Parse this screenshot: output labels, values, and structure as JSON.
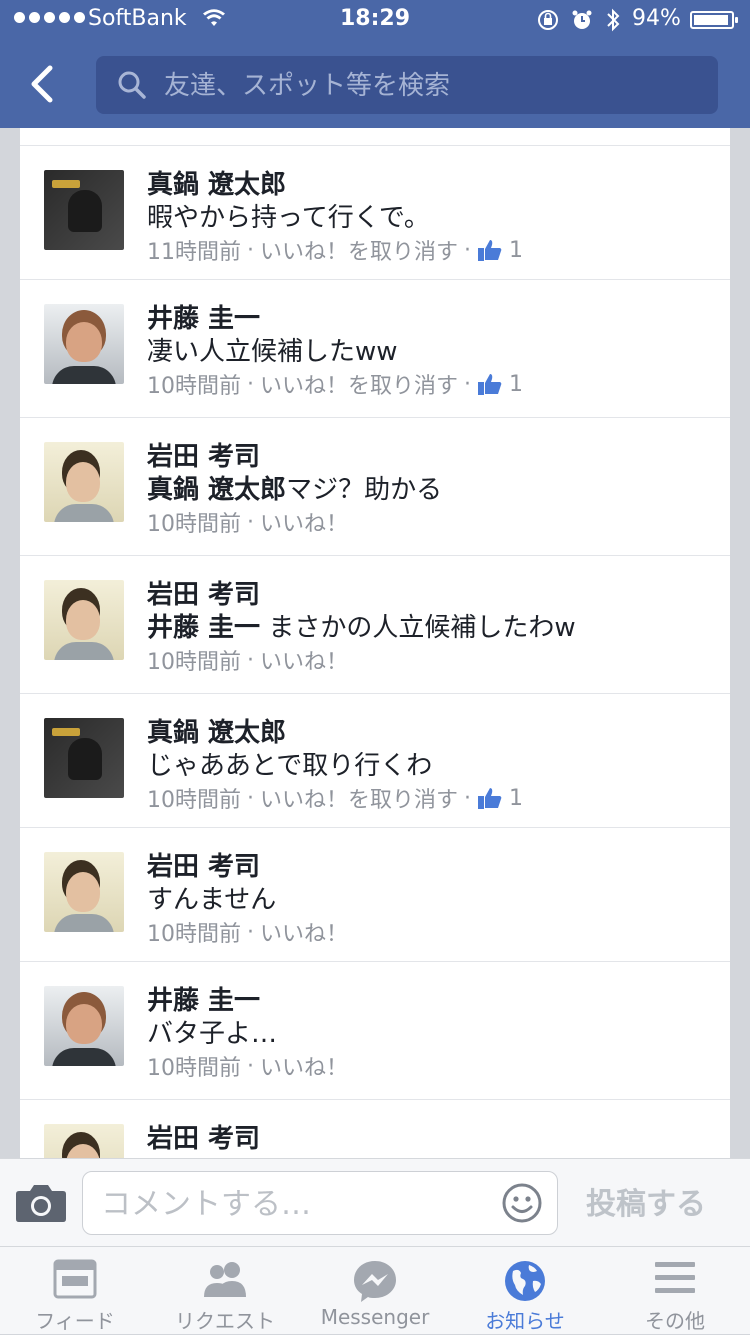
{
  "status_bar": {
    "carrier": "SoftBank",
    "time": "18:29",
    "battery_percent": "94%",
    "battery_level": 0.94
  },
  "search": {
    "placeholder": "友達、スポット等を検索"
  },
  "comments": [
    {
      "name": "真鍋 遼太郎",
      "mention": "",
      "text": "暇やから持って行くで。",
      "time": "11時間前",
      "like_action": "いいね！を取り消す",
      "like_count": "1",
      "avatar": "dark"
    },
    {
      "name": "井藤 圭一",
      "mention": "",
      "text": "凄い人立候補したww",
      "time": "10時間前",
      "like_action": "いいね！を取り消す",
      "like_count": "1",
      "avatar": "grey"
    },
    {
      "name": "岩田 考司",
      "mention": "真鍋 遼太郎",
      "text": "マジ？助かる",
      "time": "10時間前",
      "like_action": "いいね！",
      "like_count": "",
      "avatar": "cream"
    },
    {
      "name": "岩田 考司",
      "mention": "井藤 圭一",
      "text": " まさかの人立候補したわw",
      "time": "10時間前",
      "like_action": "いいね！",
      "like_count": "",
      "avatar": "cream"
    },
    {
      "name": "真鍋 遼太郎",
      "mention": "",
      "text": "じゃああとで取り行くわ",
      "time": "10時間前",
      "like_action": "いいね！を取り消す",
      "like_count": "1",
      "avatar": "dark"
    },
    {
      "name": "岩田 考司",
      "mention": "",
      "text": "すんません",
      "time": "10時間前",
      "like_action": "いいね！",
      "like_count": "",
      "avatar": "cream"
    },
    {
      "name": "井藤 圭一",
      "mention": "",
      "text": "バタ子よ…",
      "time": "10時間前",
      "like_action": "いいね！",
      "like_count": "",
      "avatar": "grey"
    },
    {
      "name": "岩田 考司",
      "mention": "",
      "text": "",
      "time": "",
      "like_action": "",
      "like_count": "",
      "avatar": "cream"
    }
  ],
  "meta_separator": "·",
  "composer": {
    "placeholder": "コメントする…",
    "post_label": "投稿する"
  },
  "tabs": [
    {
      "label": "フィード",
      "icon": "feed-icon"
    },
    {
      "label": "リクエスト",
      "icon": "friend-requests-icon"
    },
    {
      "label": "Messenger",
      "icon": "messenger-icon"
    },
    {
      "label": "お知らせ",
      "icon": "globe-notifications-icon",
      "active": true
    },
    {
      "label": "その他",
      "icon": "menu-icon"
    }
  ],
  "colors": {
    "header": "#4a67a7",
    "search_bg": "#3a5290",
    "active_tab": "#4a7bd8",
    "like_blue": "#4a7bd8"
  }
}
